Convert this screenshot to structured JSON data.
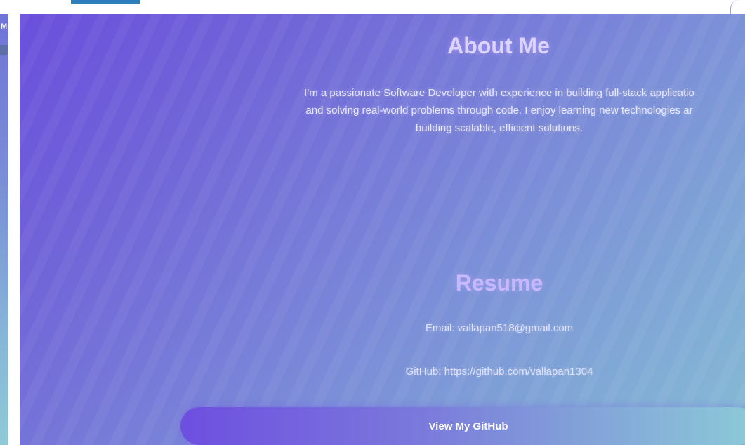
{
  "sidebar": {
    "label": "M"
  },
  "about": {
    "title": "About Me",
    "lines": [
      "I'm a passionate Software Developer with experience in building full-stack applicatio",
      "and solving real-world problems through code. I enjoy learning new technologies ar",
      "building scalable, efficient solutions."
    ]
  },
  "resume": {
    "title": "Resume",
    "email": "Email: vallapan518@gmail.com",
    "github": "GitHub: https://github.com/vallapan1304",
    "button_label": "View My GitHub"
  },
  "colors": {
    "gradient_start": "#6a4fdc",
    "gradient_end": "#86bcd4",
    "title": "#d3ccff",
    "text": "#e8e8ff",
    "top_tab": "#2f7fb8"
  }
}
